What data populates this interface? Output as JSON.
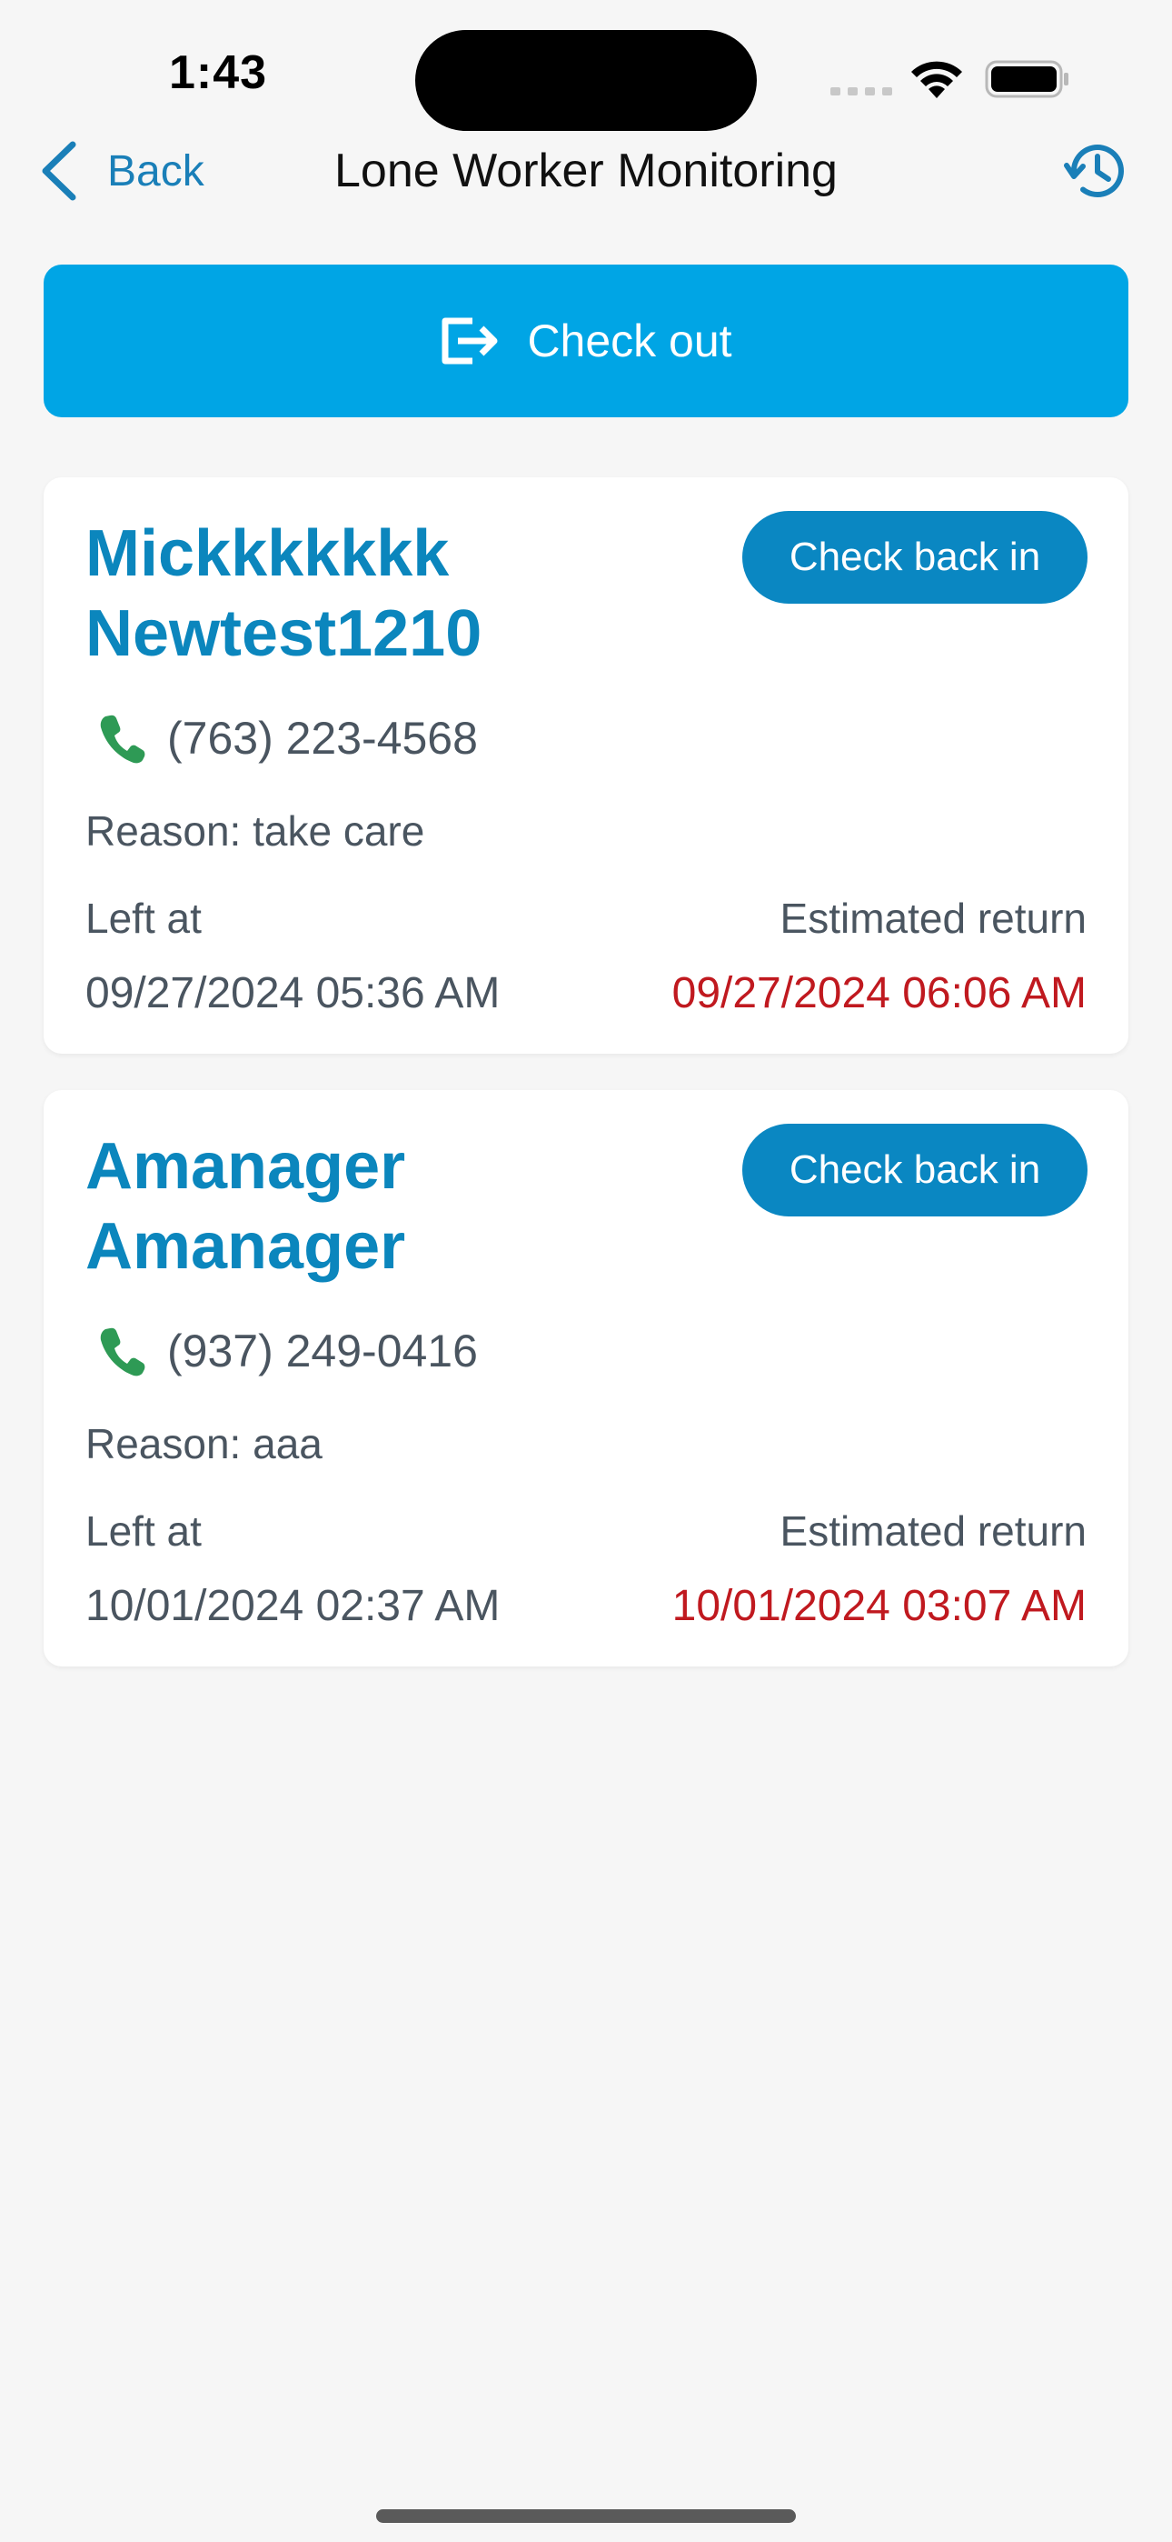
{
  "status_bar": {
    "time": "1:43",
    "icons": [
      "signal-icon",
      "wifi-icon",
      "battery-icon"
    ]
  },
  "nav": {
    "back_label": "Back",
    "title": "Lone Worker Monitoring",
    "history_icon": "history-clock-icon"
  },
  "checkout": {
    "label": "Check out",
    "icon": "exit-door-icon"
  },
  "workers": [
    {
      "name": "Mickkkkkkk Newtest1210",
      "check_in_label": "Check back in",
      "phone": "(763) 223-4568",
      "reason": "Reason: take care",
      "left_label": "Left at",
      "left_at": "09/27/2024 05:36 AM",
      "return_label": "Estimated return",
      "estimated_return": "09/27/2024 06:06 AM"
    },
    {
      "name": "Amanager Amanager",
      "check_in_label": "Check back in",
      "phone": "(937) 249-0416",
      "reason": "Reason: aaa",
      "left_label": "Left at",
      "left_at": "10/01/2024 02:37 AM",
      "return_label": "Estimated return",
      "estimated_return": "10/01/2024 03:07 AM"
    }
  ],
  "colors": {
    "accent": "#00a5e5",
    "name_blue": "#0b86bd",
    "button_blue": "#0a87c2",
    "overdue_red": "#c0191f",
    "phone_green": "#2e9a55",
    "background": "#f6f6f6"
  }
}
